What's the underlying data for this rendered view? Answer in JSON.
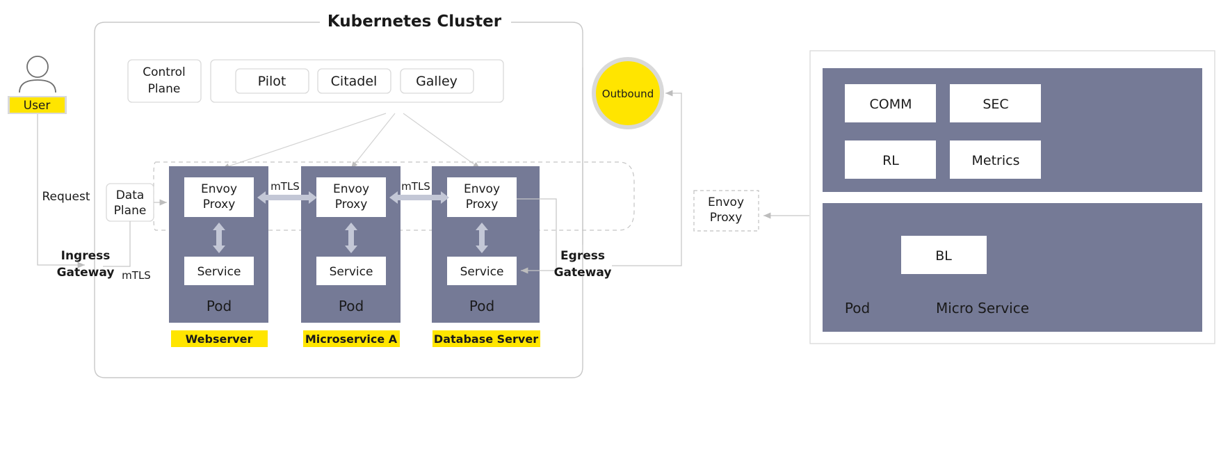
{
  "diagram": {
    "title": "Kubernetes Cluster",
    "colors": {
      "pod_fill": "#757a96",
      "highlight_yellow": "#ffe500",
      "outbound_fill": "#ffe500",
      "outbound_stroke": "#d0d0d0",
      "line_gray": "#c8c8c8",
      "arrow_blue_gray": "#c3c7d6",
      "box_stroke": "#d9d9d9",
      "text_dark": "#1a1a1a",
      "text_white": "#ffffff"
    },
    "actor": {
      "label": "User",
      "icon": "person-icon"
    },
    "flow_labels": {
      "request": "Request",
      "mtls_ingress": "mTLS",
      "mtls_1": "mTLS",
      "mtls_2": "mTLS"
    },
    "gateways": {
      "ingress_line1": "Ingress",
      "ingress_line2": "Gateway",
      "egress_line1": "Egress",
      "egress_line2": "Gateway"
    },
    "control_plane": {
      "label_line1": "Control",
      "label_line2": "Plane",
      "components": [
        "Pilot",
        "Citadel",
        "Galley"
      ]
    },
    "data_plane": {
      "label_line1": "Data",
      "label_line2": "Plane"
    },
    "pods": [
      {
        "proxy_line1": "Envoy",
        "proxy_line2": "Proxy",
        "service": "Service",
        "pod_label": "Pod",
        "tag": "Webserver"
      },
      {
        "proxy_line1": "Envoy",
        "proxy_line2": "Proxy",
        "service": "Service",
        "pod_label": "Pod",
        "tag": "Microservice A"
      },
      {
        "proxy_line1": "Envoy",
        "proxy_line2": "Proxy",
        "service": "Service",
        "pod_label": "Pod",
        "tag": "Database Server"
      }
    ],
    "outbound": {
      "label": "Outbound"
    },
    "sidecar": {
      "line1": "Envoy",
      "line2": "Proxy"
    },
    "right_panel": {
      "top_modules": [
        "COMM",
        "SEC",
        "RL",
        "Metrics"
      ],
      "bottom_module": "BL",
      "pod_label": "Pod",
      "service_label": "Micro Service"
    }
  }
}
